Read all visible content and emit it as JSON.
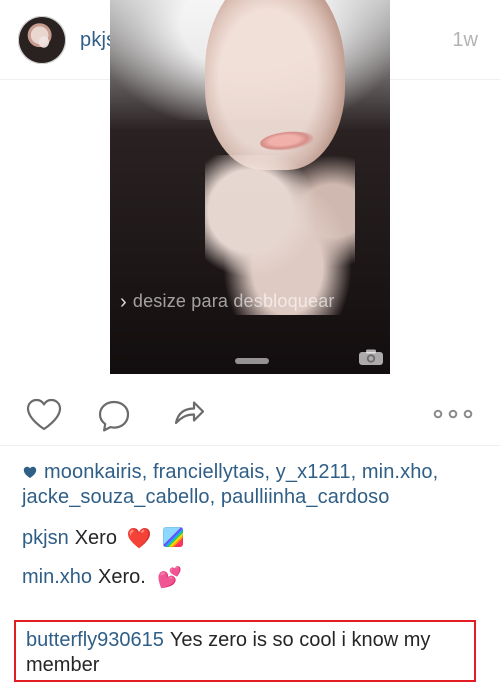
{
  "header": {
    "username": "pkjsn",
    "time": "1w"
  },
  "photo": {
    "lock_text": "desize para desbloquear"
  },
  "actions": {
    "like_icon": "heart-outline-icon",
    "comment_icon": "comment-bubble-icon",
    "share_icon": "share-arrow-icon",
    "more_icon": "more-dots-icon"
  },
  "likes": {
    "text": "moonkairis, franciellytais, y_x1211, min.xho, jacke_souza_cabello, paulliinha_cardoso"
  },
  "comments": [
    {
      "user": "pkjsn",
      "text": "Xero",
      "emoji": [
        "❤️",
        "🌈"
      ]
    },
    {
      "user": "min.xho",
      "text": "Xero.",
      "emoji": [
        "💕"
      ]
    },
    {
      "user": "butterfly930615",
      "text": "Yes zero is so cool i know my member"
    }
  ],
  "colors": {
    "link_blue": "#2f5e86",
    "highlight_red": "#e31b23"
  }
}
